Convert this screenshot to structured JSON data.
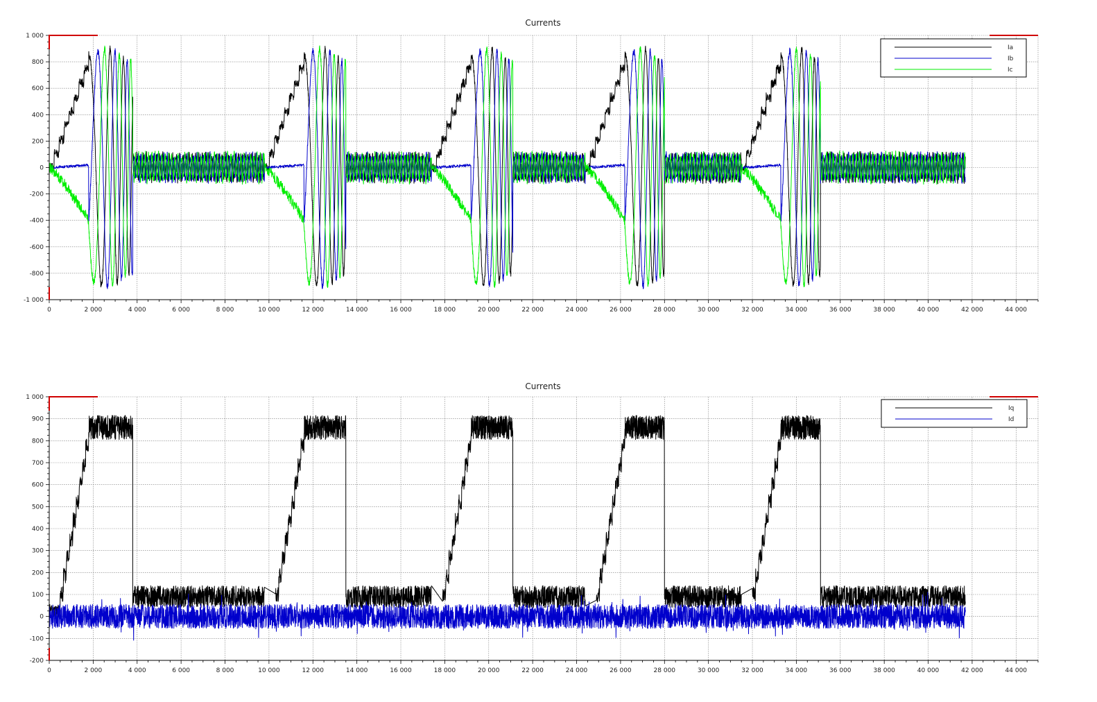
{
  "chart_data": [
    {
      "type": "line",
      "title": "Currents",
      "xlabel": "",
      "ylabel": "",
      "xlim": [
        0,
        45000
      ],
      "ylim": [
        -1000,
        1000
      ],
      "xticks": [
        0,
        2000,
        4000,
        6000,
        8000,
        10000,
        12000,
        14000,
        16000,
        18000,
        20000,
        22000,
        24000,
        26000,
        28000,
        30000,
        32000,
        34000,
        36000,
        38000,
        40000,
        42000,
        44000
      ],
      "xtick_labels": [
        "0",
        "2 000",
        "4 000",
        "6 000",
        "8 000",
        "10 000",
        "12 000",
        "14 000",
        "16 000",
        "18 000",
        "20 000",
        "22 000",
        "24 000",
        "26 000",
        "28 000",
        "30 000",
        "32 000",
        "34 000",
        "36 000",
        "38 000",
        "40 000",
        "42 000",
        "44 000"
      ],
      "yticks": [
        -1000,
        -800,
        -600,
        -400,
        -200,
        0,
        200,
        400,
        600,
        800,
        1000
      ],
      "ytick_labels": [
        "-1 000",
        "-800",
        "-600",
        "-400",
        "-200",
        "0",
        "200",
        "400",
        "600",
        "800",
        "1 000"
      ],
      "grid": true,
      "legend_position": "top-right",
      "series": [
        {
          "name": "Ia",
          "color": "#000000"
        },
        {
          "name": "Ib",
          "color": "#0000cc"
        },
        {
          "name": "Ic",
          "color": "#00ee00"
        }
      ],
      "cycles": [
        {
          "start": 0,
          "accel_end": 1800,
          "spin_end": 3800,
          "idle_end": 9800
        },
        {
          "start": 9800,
          "accel_end": 11600,
          "spin_end": 13500,
          "idle_end": 17400
        },
        {
          "start": 17400,
          "accel_end": 19200,
          "spin_end": 21100,
          "idle_end": 24400
        },
        {
          "start": 24400,
          "accel_end": 26200,
          "spin_end": 28000,
          "idle_end": 31500
        },
        {
          "start": 31500,
          "accel_end": 33300,
          "spin_end": 35100,
          "idle_end": 41700
        }
      ],
      "peak_amplitude": 900,
      "ramp_peak": 850,
      "ramp_trough": -400,
      "idle_amplitude": 110
    },
    {
      "type": "line",
      "title": "Currents",
      "xlabel": "",
      "ylabel": "",
      "xlim": [
        0,
        45000
      ],
      "ylim": [
        -200,
        1000
      ],
      "xticks": [
        0,
        2000,
        4000,
        6000,
        8000,
        10000,
        12000,
        14000,
        16000,
        18000,
        20000,
        22000,
        24000,
        26000,
        28000,
        30000,
        32000,
        34000,
        36000,
        38000,
        40000,
        42000,
        44000
      ],
      "xtick_labels": [
        "0",
        "2 000",
        "4 000",
        "6 000",
        "8 000",
        "10 000",
        "12 000",
        "14 000",
        "16 000",
        "18 000",
        "20 000",
        "22 000",
        "24 000",
        "26 000",
        "28 000",
        "30 000",
        "32 000",
        "34 000",
        "36 000",
        "38 000",
        "40 000",
        "42 000",
        "44 000"
      ],
      "yticks": [
        -200,
        -100,
        0,
        100,
        200,
        300,
        400,
        500,
        600,
        700,
        800,
        900,
        1000
      ],
      "ytick_labels": [
        "-200",
        "-100",
        "0",
        "100",
        "200",
        "300",
        "400",
        "500",
        "600",
        "700",
        "800",
        "900",
        "1 000"
      ],
      "grid": true,
      "legend_position": "top-right",
      "series": [
        {
          "name": "Iq",
          "color": "#000000"
        },
        {
          "name": "Id",
          "color": "#0000cc"
        }
      ],
      "cycles": [
        {
          "start": 500,
          "plateau_start": 1800,
          "drop": 3800,
          "idle_end": 9800
        },
        {
          "start": 10300,
          "plateau_start": 11600,
          "drop": 13500,
          "idle_end": 17400
        },
        {
          "start": 17900,
          "plateau_start": 19200,
          "drop": 21100,
          "idle_end": 24400
        },
        {
          "start": 24900,
          "plateau_start": 26200,
          "drop": 28000,
          "idle_end": 31500
        },
        {
          "start": 32000,
          "plateau_start": 33300,
          "drop": 35100,
          "idle_end": 41700
        }
      ],
      "iq_plateau": 860,
      "iq_idle": 90,
      "id_level": 0
    }
  ]
}
